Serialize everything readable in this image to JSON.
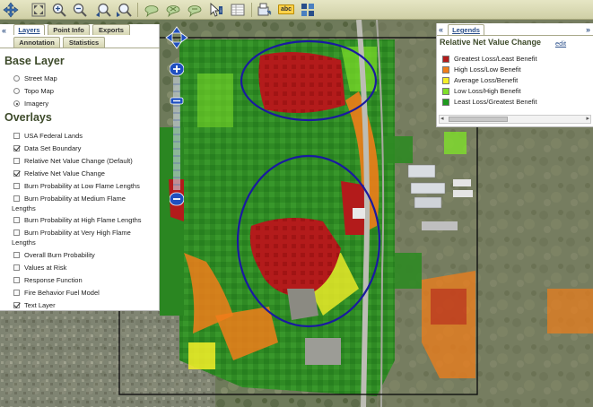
{
  "toolbar": {
    "icons": [
      "pan-icon",
      "zoom-extent-icon",
      "zoom-in-icon",
      "zoom-out-icon",
      "zoom-previous-icon",
      "zoom-next-icon",
      "select-area-icon",
      "clear-selection-icon",
      "select-polygon-icon",
      "identify-icon",
      "table-icon",
      "print-icon",
      "label-abc-icon",
      "layers-icon"
    ],
    "abc_label": "abc"
  },
  "left_panel": {
    "collapse_glyph": "«",
    "tabs": [
      {
        "label": "Layers",
        "active": true
      },
      {
        "label": "Point Info",
        "active": false
      },
      {
        "label": "Exports",
        "active": false
      },
      {
        "label": "Annotation",
        "active": false
      },
      {
        "label": "Statistics",
        "active": false
      }
    ],
    "base_layer": {
      "title": "Base Layer",
      "options": [
        {
          "label": "Street Map",
          "selected": false
        },
        {
          "label": "Topo Map",
          "selected": false
        },
        {
          "label": "Imagery",
          "selected": true
        }
      ]
    },
    "overlays": {
      "title": "Overlays",
      "items": [
        {
          "label": "USA Federal Lands",
          "checked": false
        },
        {
          "label": "Data Set Boundary",
          "checked": true
        },
        {
          "label": "Relative Net Value Change (Default)",
          "checked": false
        },
        {
          "label": "Relative Net Value Change",
          "checked": true
        },
        {
          "label": "Burn Probability at Low Flame Lengths",
          "checked": false
        },
        {
          "label": "Burn Probability at Medium Flame",
          "label2": "Lengths",
          "checked": false
        },
        {
          "label": "Burn Probability at High Flame Lengths",
          "checked": false
        },
        {
          "label": "Burn Probability at Very High Flame",
          "label2": "Lengths",
          "checked": false
        },
        {
          "label": "Overall Burn Probability",
          "checked": false
        },
        {
          "label": "Values at Risk",
          "checked": false
        },
        {
          "label": "Response Function",
          "checked": false
        },
        {
          "label": "Fire Behavior Fuel Model",
          "checked": false
        },
        {
          "label": "Text Layer",
          "checked": true
        }
      ]
    }
  },
  "legend_panel": {
    "collapse_glyph": "«",
    "expand_glyph": "»",
    "tab_label": "Legends",
    "title": "Relative Net Value Change",
    "edit_label": "edit",
    "items": [
      {
        "label": "Greatest Loss/Least Benefit",
        "color": "#b31b1b"
      },
      {
        "label": "High Loss/Low Benefit",
        "color": "#f07d1a"
      },
      {
        "label": "Average Loss/Benefit",
        "color": "#f5ef28"
      },
      {
        "label": "Low Loss/High Benefit",
        "color": "#7fe02a"
      },
      {
        "label": "Least Loss/Greatest Benefit",
        "color": "#1f9a1f"
      }
    ],
    "scroll_left": "◂",
    "scroll_right": "▸"
  },
  "map_controls": {
    "pan_icons": [
      "pan-up-icon",
      "pan-left-icon",
      "pan-right-icon",
      "pan-down-icon"
    ],
    "zoom_in_glyph": "+",
    "zoom_out_glyph": "−"
  },
  "colors": {
    "greatest_loss": "#b31b1b",
    "high_loss": "#f07d1a",
    "average": "#f5ef28",
    "low_loss": "#7fe02a",
    "least_loss": "#1f9a1f",
    "highlight_ellipse": "#1a1aa0"
  }
}
